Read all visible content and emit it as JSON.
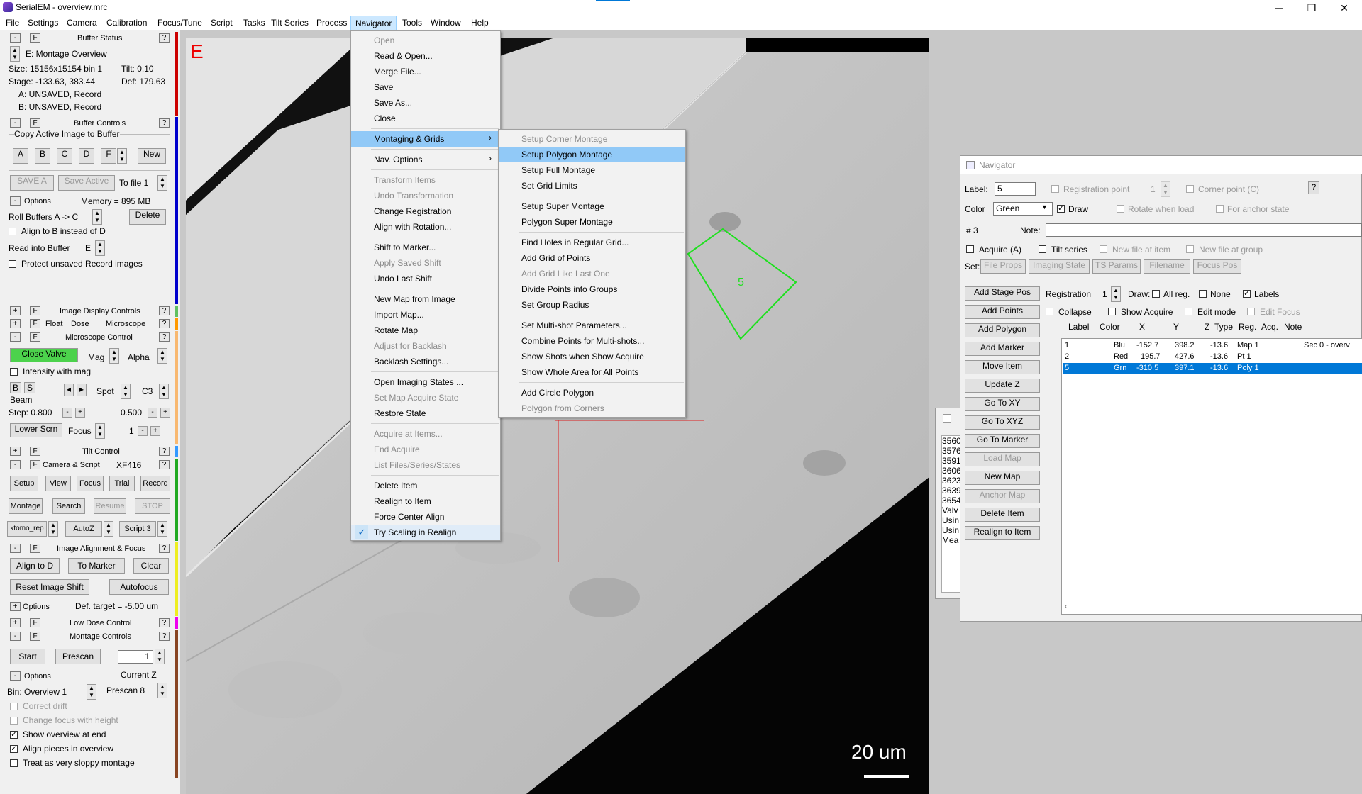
{
  "app": {
    "title": "SerialEM - overview.mrc"
  },
  "window_controls": {
    "minimize": "─",
    "maximize": "❐",
    "close": "✕"
  },
  "menubar": [
    "File",
    "Settings",
    "Camera",
    "Calibration",
    "Focus/Tune",
    "Script",
    "Tasks",
    "Tilt Series",
    "Process",
    "Navigator",
    "Tools",
    "Window",
    "Help"
  ],
  "buffer_status": {
    "title": "Buffer Status",
    "buffer": "E: Montage Overview",
    "size": "Size: 15156x15154  bin 1",
    "tilt": "Tilt: 0.10",
    "stage": "Stage: -133.63, 383.44",
    "def": "Def: 179.63",
    "a": "A: UNSAVED, Record",
    "b": "B: UNSAVED, Record"
  },
  "buffer_controls": {
    "title": "Buffer Controls",
    "group_label": "Copy Active Image to Buffer",
    "buffers": [
      "A",
      "B",
      "C",
      "D",
      "F"
    ],
    "new": "New",
    "save_a": "SAVE A",
    "save_active": "Save Active",
    "to_file": "To file 1",
    "options": "Options",
    "memory": "Memory = 895 MB",
    "roll": "Roll Buffers A ->   C",
    "delete": "Delete",
    "align_b": "Align to B instead of D",
    "read_into": "Read into Buffer",
    "read_buf": "E",
    "protect": "Protect unsaved Record images"
  },
  "image_display": {
    "title": "Image Display Controls"
  },
  "low_dose_small": {
    "float": "Float",
    "dose": "Dose",
    "microscope": "Microscope"
  },
  "microscope": {
    "title": "Microscope Control",
    "close_valve": "Close Valve",
    "mag": "Mag",
    "alpha": "Alpha",
    "intensity": "Intensity with mag",
    "b": "B",
    "s": "S",
    "beam": "Beam",
    "spot": "Spot",
    "c3": "C3",
    "step1": "Step:  0.800",
    "step2": "0.500",
    "lower_scrn": "Lower Scrn",
    "focus": "Focus",
    "focus_val": "1"
  },
  "tilt": {
    "title": "Tilt Control"
  },
  "camera_script": {
    "title": "Camera & Script",
    "camera": "XF416",
    "buttons": [
      "Setup",
      "View",
      "Focus",
      "Trial",
      "Record"
    ],
    "montage": "Montage",
    "search": "Search",
    "resume": "Resume",
    "stop": "STOP",
    "script_name": "ktomo_rep",
    "autoz": "AutoZ",
    "script3": "Script 3"
  },
  "image_alignment": {
    "title": "Image Alignment & Focus",
    "align_d": "Align to D",
    "to_marker": "To Marker",
    "clear": "Clear",
    "reset_shift": "Reset Image Shift",
    "autofocus": "Autofocus",
    "options": "Options",
    "def_target": "Def. target = -5.00 um"
  },
  "low_dose": {
    "title": "Low Dose Control"
  },
  "montage_controls": {
    "title": "Montage Controls",
    "start": "Start",
    "prescan": "Prescan",
    "z_val": "1",
    "options": "Options",
    "current_z": "Current Z",
    "bin": "Bin: Overview 1",
    "prescan8": "Prescan 8",
    "correct_drift": "Correct drift",
    "change_focus": "Change focus with height",
    "show_overview": "Show overview at end",
    "align_pieces": "Align pieces in overview",
    "sloppy": "Treat as very sloppy montage"
  },
  "image": {
    "buffer_letter": "E",
    "polygon_label": "5",
    "scale": "20 um"
  },
  "navigator_menu": [
    "Open",
    "Read & Open...",
    "Merge File...",
    "Save",
    "Save As...",
    "Close",
    "Montaging & Grids",
    "Nav. Options",
    "Transform Items",
    "Undo Transformation",
    "Change Registration",
    "Align with Rotation...",
    "Shift to Marker...",
    "Apply Saved Shift",
    "Undo Last Shift",
    "New Map from Image",
    "Import Map...",
    "Rotate Map",
    "Adjust for Backlash",
    "Backlash Settings...",
    "Open Imaging States ...",
    "Set Map Acquire State",
    "Restore State",
    "Acquire at Items...",
    "End Acquire",
    "List Files/Series/States",
    "Delete Item",
    "Realign to Item",
    "Force Center Align",
    "Try Scaling in Realign"
  ],
  "submenu": [
    "Setup Corner Montage",
    "Setup Polygon Montage",
    "Setup Full Montage",
    "Set Grid Limits",
    "Setup Super Montage",
    "Polygon Super Montage",
    "Find Holes in Regular Grid...",
    "Add Grid of Points",
    "Add Grid Like Last One",
    "Divide Points into Groups",
    "Set Group Radius",
    "Set Multi-shot Parameters...",
    "Combine Points for Multi-shots...",
    "Show Shots when Show Acquire",
    "Show Whole Area for All Points",
    "Add Circle Polygon",
    "Polygon from Corners"
  ],
  "navigator": {
    "title": "Navigator",
    "label": "Label:",
    "label_val": "5",
    "reg_point": "Registration point",
    "reg_val": "1",
    "corner": "Corner point (C)",
    "help": "?",
    "color": "Color",
    "color_val": "Green",
    "draw": "Draw",
    "rotate": "Rotate when load",
    "anchor": "For anchor state",
    "item_num": "# 3",
    "note": "Note:",
    "acquire": "Acquire (A)",
    "tilt_series": "Tilt series",
    "new_file": "New file at item",
    "new_file_group": "New file at group",
    "set": "Set:",
    "file_props": "File Props",
    "imaging_state": "Imaging State",
    "ts_params": "TS Params",
    "filename": "Filename",
    "focus_pos": "Focus Pos",
    "registration": "Registration",
    "reg_num": "1",
    "draw_label": "Draw:",
    "all_reg": "All reg.",
    "none": "None",
    "labels": "Labels",
    "collapse": "Collapse",
    "show_acquire": "Show Acquire",
    "edit_mode": "Edit mode",
    "edit_focus": "Edit Focus",
    "buttons": [
      "Add Stage Pos",
      "Add Points",
      "Add Polygon",
      "Add Marker",
      "Move Item",
      "Update Z",
      "Go To XY",
      "Go To XYZ",
      "Go To Marker",
      "Load Map",
      "New Map",
      "Anchor Map",
      "Delete Item",
      "Realign to Item"
    ],
    "columns": [
      "Label",
      "Color",
      "X",
      "Y",
      "Z",
      "Type",
      "Reg.",
      "Acq.",
      "Note"
    ],
    "rows": [
      {
        "label": "1",
        "color": "Blu",
        "x": "-152.7",
        "y": "398.2",
        "z": "-13.6",
        "type": "Map 1",
        "note": "Sec 0 - overv"
      },
      {
        "label": "2",
        "color": "Red",
        "x": "195.7",
        "y": "427.6",
        "z": "-13.6",
        "type": "Pt   1",
        "note": ""
      },
      {
        "label": "5",
        "color": "Grn",
        "x": "-310.5",
        "y": "397.1",
        "z": "-13.6",
        "type": "Poly 1",
        "note": ""
      }
    ]
  },
  "log": {
    "lines": [
      "3560",
      "3576",
      "3591",
      "3606",
      "3623",
      "3639",
      "3654",
      "Valv",
      "Usin",
      "Usin",
      "Mea"
    ]
  }
}
